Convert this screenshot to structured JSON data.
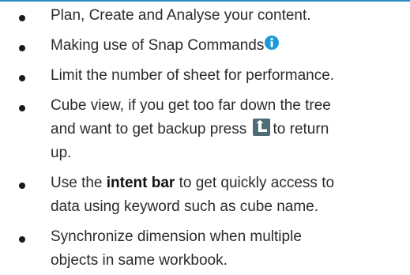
{
  "items": [
    {
      "text": "Plan, Create and Analyse your content."
    },
    {
      "text": "Making use of Snap Commands",
      "icon": "info-icon"
    },
    {
      "text": "Limit the number of sheet for performance."
    },
    {
      "line1": "Cube view, if you get too far down the tree",
      "line2_pre": "and want to get backup press",
      "line2_post": "to return",
      "line3": "up.",
      "icon": "back-up-arrow-icon"
    },
    {
      "pre": "Use the",
      "bold": "intent bar",
      "post": "to get quickly access to",
      "line2": "data using keyword such as cube name."
    },
    {
      "line1": "Synchronize dimension when multiple",
      "line2": "objects in same workbook."
    }
  ],
  "colors": {
    "accent_rule": "#2a8fbf",
    "info_icon": "#1c9ad6",
    "back_icon": "#4d6e78"
  }
}
